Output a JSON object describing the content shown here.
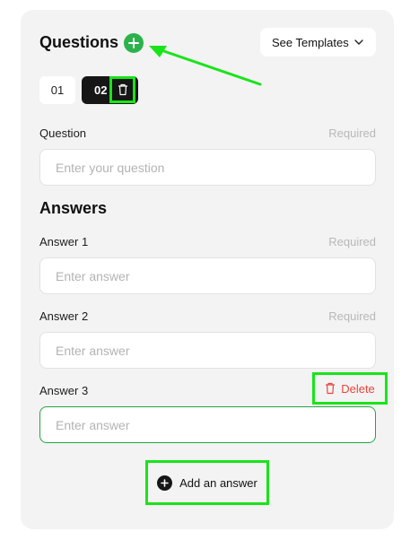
{
  "questions": {
    "title": "Questions",
    "templates_label": "See Templates",
    "tabs": [
      {
        "label": "01"
      },
      {
        "label": "02"
      }
    ],
    "question_label": "Question",
    "required": "Required",
    "question_placeholder": "Enter your question"
  },
  "answers": {
    "title": "Answers",
    "items": [
      {
        "label": "Answer 1",
        "status": "Required",
        "placeholder": "Enter answer"
      },
      {
        "label": "Answer 2",
        "status": "Required",
        "placeholder": "Enter answer"
      },
      {
        "label": "Answer 3",
        "placeholder": "Enter answer"
      }
    ],
    "delete_label": "Delete",
    "add_label": "Add an answer"
  },
  "colors": {
    "accent_green": "#2bb24c",
    "annotation_green": "#19e419",
    "delete_red": "#e8453c"
  }
}
